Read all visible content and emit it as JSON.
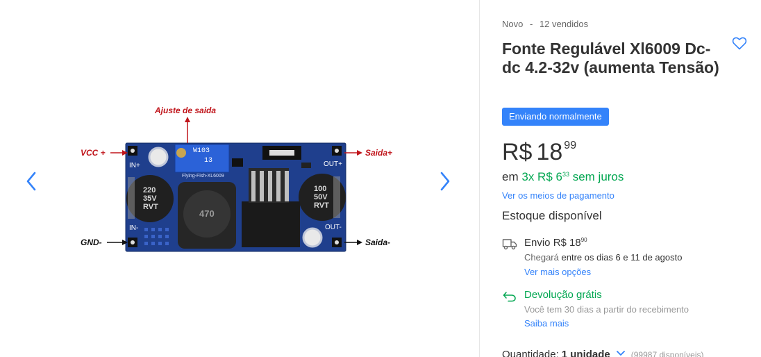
{
  "gallery": {
    "prev_icon": "chevron-left-icon",
    "next_icon": "chevron-right-icon",
    "image": {
      "labels": {
        "adjust": "Ajuste de saida",
        "vcc": "VCC +",
        "gnd": "GND-",
        "out_plus": "Saida+",
        "out_minus": "Saida-",
        "in_plus": "IN+",
        "in_minus": "IN-",
        "out_plus_pin": "OUT+",
        "out_minus_pin": "OUT-",
        "pot_code": "W103",
        "pot_code2": "13",
        "board_name": "Flying-Fish-XL6009",
        "cap_left": [
          "220",
          "35V",
          "RVT"
        ],
        "cap_right": [
          "100",
          "50V",
          "RVT"
        ],
        "inductor": "470"
      }
    }
  },
  "product": {
    "condition": "Novo",
    "separator": "-",
    "sold": "12 vendidos",
    "title": "Fonte Regulável Xl6009 Dc-dc 4.2-32v (aumenta Tensão)",
    "favorite_icon": "heart-icon",
    "badge": "Enviando normalmente",
    "price": {
      "currency": "R$",
      "integer": "18",
      "cents": "99"
    },
    "installments": {
      "prefix": "em",
      "count": "3x R$ 6",
      "cents": "33",
      "suffix": "sem juros"
    },
    "payment_link": "Ver os meios de pagamento",
    "stock": "Estoque disponível"
  },
  "shipping": {
    "icon": "truck-icon",
    "label": "Envio R$ 18",
    "cents": "90",
    "arrives_prefix": "Chegará",
    "arrives_text": "entre os dias 6 e 11 de agosto",
    "more": "Ver mais opções"
  },
  "returns": {
    "icon": "return-arrow-icon",
    "title": "Devolução grátis",
    "desc": "Você tem 30 dias a partir do recebimento",
    "more": "Saiba mais"
  },
  "quantity": {
    "label": "Quantidade:",
    "selected": "1 unidade",
    "chevron_icon": "chevron-down-icon",
    "available": "(99987 disponíveis)"
  },
  "colors": {
    "accent": "#3483fa",
    "green": "#00a650",
    "board": "#1e3f8a"
  }
}
